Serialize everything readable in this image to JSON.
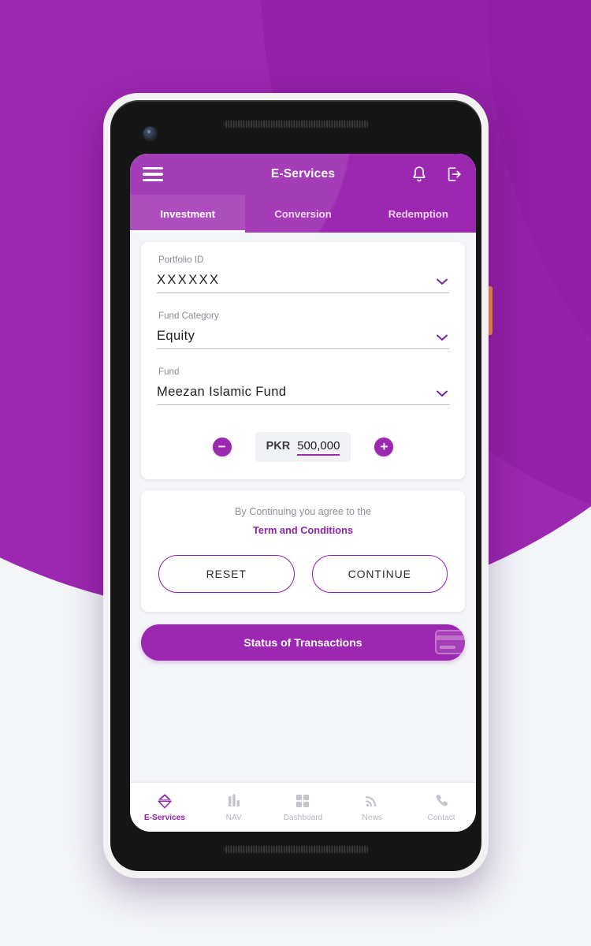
{
  "app": {
    "header": {
      "title": "E-Services",
      "menu_icon": "hamburger-menu-icon",
      "notification_icon": "bell-icon",
      "logout_icon": "logout-icon"
    },
    "tabs": [
      {
        "label": "Investment",
        "active": true
      },
      {
        "label": "Conversion",
        "active": false
      },
      {
        "label": "Redemption",
        "active": false
      }
    ],
    "form": {
      "fields": [
        {
          "label": "Portfolio ID",
          "value": "XXXXXX",
          "icon": "chevron-down-icon"
        },
        {
          "label": "Fund Category",
          "value": "Equity",
          "icon": "chevron-down-icon"
        },
        {
          "label": "Fund",
          "value": "Meezan Islamic Fund",
          "icon": "chevron-down-icon"
        }
      ],
      "amount": {
        "decrement_label": "−",
        "increment_label": "+",
        "currency": "PKR",
        "value": "500,000"
      }
    },
    "terms": {
      "note": "By Continuing you agree to the",
      "link": "Term and Conditions",
      "reset_label": "RESET",
      "continue_label": "CONTINUE"
    },
    "status_banner": {
      "label": "Status of Transactions",
      "icon": "credit-card-icon"
    },
    "bottom_nav": [
      {
        "label": "E-Services",
        "icon": "eservices-logo-icon",
        "active": true
      },
      {
        "label": "NAV",
        "icon": "bar-chart-icon",
        "active": false
      },
      {
        "label": "Dashboard",
        "icon": "grid-icon",
        "active": false
      },
      {
        "label": "News",
        "icon": "rss-icon",
        "active": false
      },
      {
        "label": "Contact",
        "icon": "phone-icon",
        "active": false
      }
    ]
  },
  "colors": {
    "brand_purple": "#9c27b0",
    "link_purple": "#8e24aa",
    "backdrop": "#f4f5f9",
    "power_button": "#f08a5d"
  },
  "device": {
    "front_camera": "front-camera-icon",
    "earpiece_speaker": "earpiece-speaker",
    "bottom_speaker": "bottom-speaker",
    "power_button": "power-button"
  }
}
